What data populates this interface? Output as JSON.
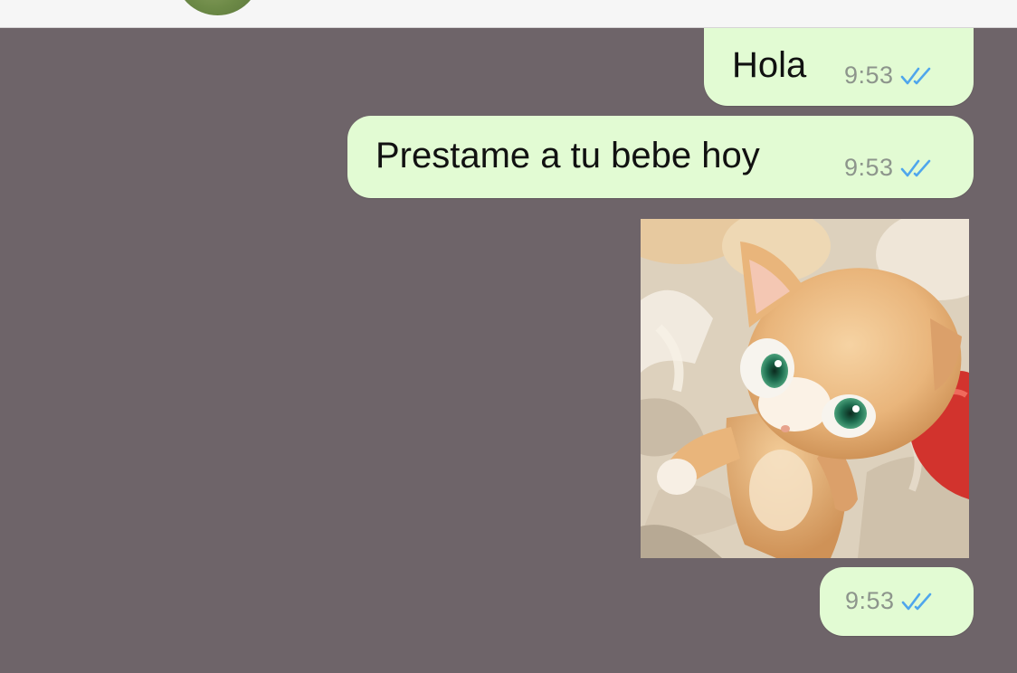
{
  "header": {
    "avatar_icon": "contact-avatar"
  },
  "messages": [
    {
      "text": "Hola",
      "time": "9:53",
      "status": "read",
      "status_icon": "double-check-icon"
    },
    {
      "text": "Prestame a tu bebe hoy",
      "time": "9:53",
      "status": "read",
      "status_icon": "double-check-icon"
    },
    {
      "media": "image",
      "subject": "kitten-sticker-image"
    },
    {
      "text": "",
      "time": "9:53",
      "status": "read",
      "status_icon": "double-check-icon"
    }
  ],
  "colors": {
    "chat_background": "#6e6469",
    "outgoing_bubble": "#e2fbd3",
    "read_ticks": "#4fa6ec",
    "timestamp": "#8d958c"
  }
}
